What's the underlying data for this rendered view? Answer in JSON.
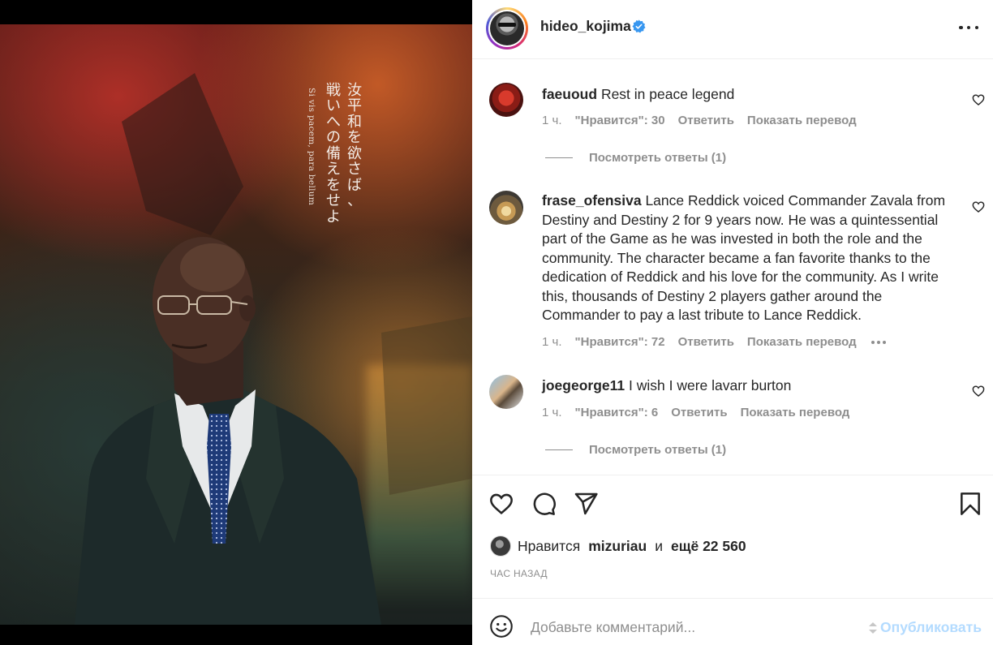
{
  "post": {
    "username": "hideo_kojima",
    "verified": true,
    "image": {
      "jp_line_1": [
        "汝",
        "平",
        "和",
        "を",
        "欲",
        "さ",
        "ば",
        "、"
      ],
      "jp_line_2": [
        "戦",
        "い",
        "へ",
        "の",
        "備",
        "え",
        "を",
        "せ",
        "よ"
      ],
      "latin": "Si vis pacem, para bellum"
    }
  },
  "comments": [
    {
      "username": "faeuoud",
      "text": "Rest in peace legend",
      "time": "1 ч.",
      "likes": "\"Нравится\": 30",
      "reply": "Ответить",
      "translate": "Показать перевод",
      "view_replies": "Посмотреть ответы (1)"
    },
    {
      "username": "frase_ofensiva",
      "text": "Lance Reddick voiced Commander Zavala from Destiny and Destiny 2 for 9 years now. He was a quintessential part of the Game as he was invested in both the role and the community. The character became a fan favorite thanks to the dedication of Reddick and his love for the community. As I write this, thousands of Destiny 2 players gather around the Commander to pay a last tribute to Lance Reddick.",
      "time": "1 ч.",
      "likes": "\"Нравится\": 72",
      "reply": "Ответить",
      "translate": "Показать перевод"
    },
    {
      "username": "joegeorge11",
      "text": "I wish I were lavarr burton",
      "time": "1 ч.",
      "likes": "\"Нравится\": 6",
      "reply": "Ответить",
      "translate": "Показать перевод",
      "view_replies": "Посмотреть ответы (1)"
    }
  ],
  "actions": {
    "icons": [
      "heart-icon",
      "comment-icon",
      "share-icon",
      "bookmark-icon"
    ]
  },
  "likes": {
    "prefix": "Нравится",
    "user": "mizuriau",
    "conjunction": "и",
    "more": "ещё 22 560"
  },
  "time_ago": "ЧАС НАЗАД",
  "comment_box": {
    "placeholder": "Добавьте комментарий...",
    "publish": "Опубликовать"
  },
  "colors": {
    "text": "#262626",
    "muted": "#8e8e8e",
    "publish_disabled": "#b3dbff",
    "verified": "#3897f0"
  }
}
